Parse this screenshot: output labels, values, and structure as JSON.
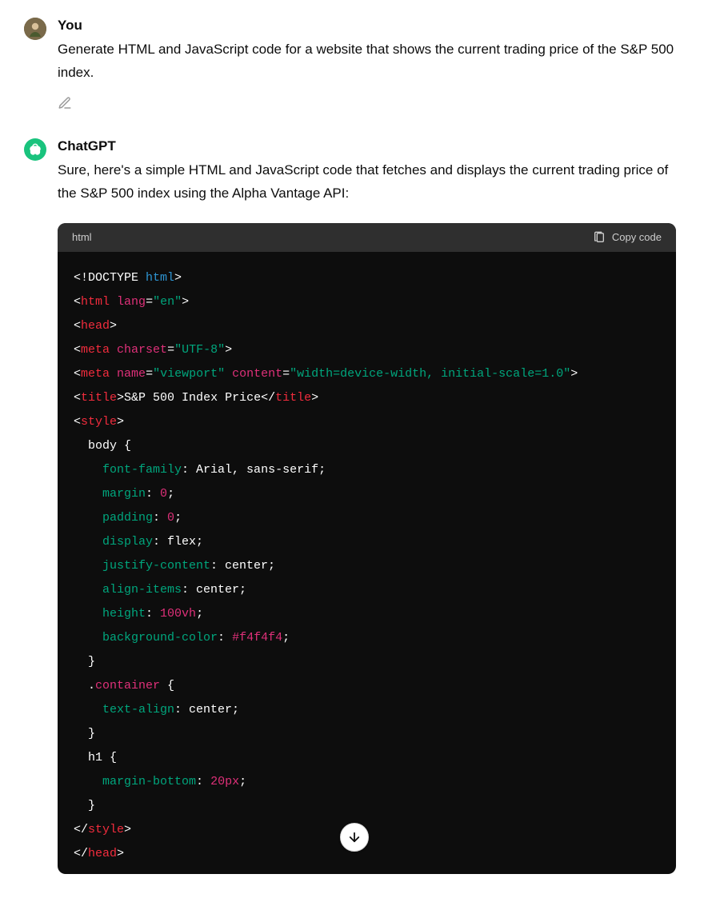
{
  "user": {
    "sender_label": "You",
    "message": "Generate HTML and JavaScript code for a website that shows the current trading price of the S&P 500 index."
  },
  "assistant": {
    "sender_label": "ChatGPT",
    "message": "Sure, here's a simple HTML and JavaScript code that fetches and displays the current trading price of the S&P 500 index using the Alpha Vantage API:"
  },
  "code": {
    "language_label": "html",
    "copy_label": "Copy code",
    "tokens": {
      "doctype_open": "<!DOCTYPE ",
      "doctype_html": "html",
      "doctype_close": ">",
      "html_open_lt": "<",
      "html_tag": "html",
      "sp": " ",
      "lang_attr": "lang",
      "eq": "=",
      "lang_val": "\"en\"",
      "gt": ">",
      "head_open_lt": "<",
      "head_tag": "head",
      "head_close_gt": ">",
      "meta_tag": "meta",
      "charset_attr": "charset",
      "charset_val": "\"UTF-8\"",
      "name_attr": "name",
      "viewport_val": "\"viewport\"",
      "content_attr": "content",
      "content_val": "\"width=device-width, initial-scale=1.0\"",
      "title_tag": "title",
      "title_text": "S&P 500 Index Price",
      "title_close": "</",
      "style_tag": "style",
      "css_body_sel": "  body {",
      "css_ff_prop": "font-family",
      "css_ff_val": ": Arial, sans-serif;",
      "css_margin_prop": "margin",
      "css_colon_sp": ": ",
      "css_zero": "0",
      "css_semi": ";",
      "css_padding_prop": "padding",
      "css_display_prop": "display",
      "css_flex_val": ": flex;",
      "css_jc_prop": "justify-content",
      "css_center_val": ": center;",
      "css_ai_prop": "align-items",
      "css_height_prop": "height",
      "css_100vh": "100vh",
      "css_bg_prop": "background-color",
      "css_bg_val": "#f4f4f4",
      "css_close_brace": "  }",
      "css_container_sel_dot": "  .",
      "css_container_sel": "container",
      "css_open_brace_sp": " {",
      "css_ta_prop": "text-align",
      "css_h1_sel": "  h1 {",
      "css_mb_prop": "margin-bottom",
      "css_20px": "20px",
      "style_close": "</",
      "head_close": "</",
      "head_close_tag": "head"
    }
  }
}
